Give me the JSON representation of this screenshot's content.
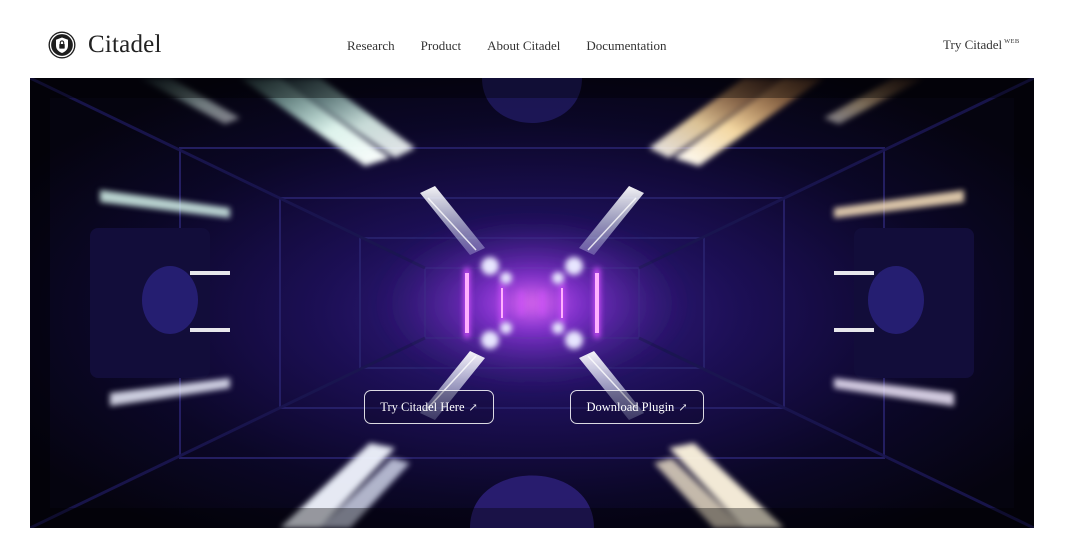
{
  "brand": {
    "name": "Citadel",
    "icon": "shield-lock-icon"
  },
  "nav": {
    "items": [
      {
        "label": "Research"
      },
      {
        "label": "Product"
      },
      {
        "label": "About Citadel"
      },
      {
        "label": "Documentation"
      }
    ]
  },
  "cta": {
    "label": "Try Citadel",
    "badge": "WEB"
  },
  "hero": {
    "buttons": [
      {
        "label": "Try Citadel Here",
        "icon": "external-arrow-icon",
        "arrow": "↗"
      },
      {
        "label": "Download Plugin",
        "icon": "external-arrow-icon",
        "arrow": "↗"
      }
    ]
  },
  "colors": {
    "background": "#ffffff",
    "hero_background": "#07051a",
    "neon_purple": "#c040ff",
    "warm_light": "#ffd98a",
    "cool_light": "#c8fff0"
  }
}
